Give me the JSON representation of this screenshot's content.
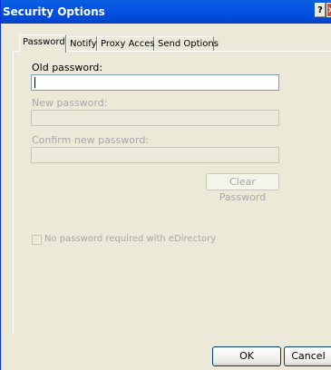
{
  "window": {
    "title": "Security Options",
    "help_glyph": "?",
    "close_glyph": "×"
  },
  "tabs": [
    {
      "label": "Password",
      "active": true
    },
    {
      "label": "Notify",
      "active": false
    },
    {
      "label": "Proxy Access",
      "active": false
    },
    {
      "label": "Send Options",
      "active": false
    }
  ],
  "form": {
    "old_password_label": "Old password:",
    "old_password_value": "",
    "new_password_label": "New password:",
    "new_password_value": "",
    "confirm_password_label": "Confirm new password:",
    "confirm_password_value": "",
    "clear_password_label": "Clear Password",
    "no_password_checkbox_label": "No password required with eDirectory",
    "no_password_checked": false
  },
  "footer": {
    "ok_label": "OK",
    "cancel_label": "Cancel"
  },
  "colors": {
    "titlebar": "#0054e3",
    "dialog_bg": "#ece9d8",
    "disabled_text": "#a7a6aa",
    "field_border": "#7f9db9"
  }
}
